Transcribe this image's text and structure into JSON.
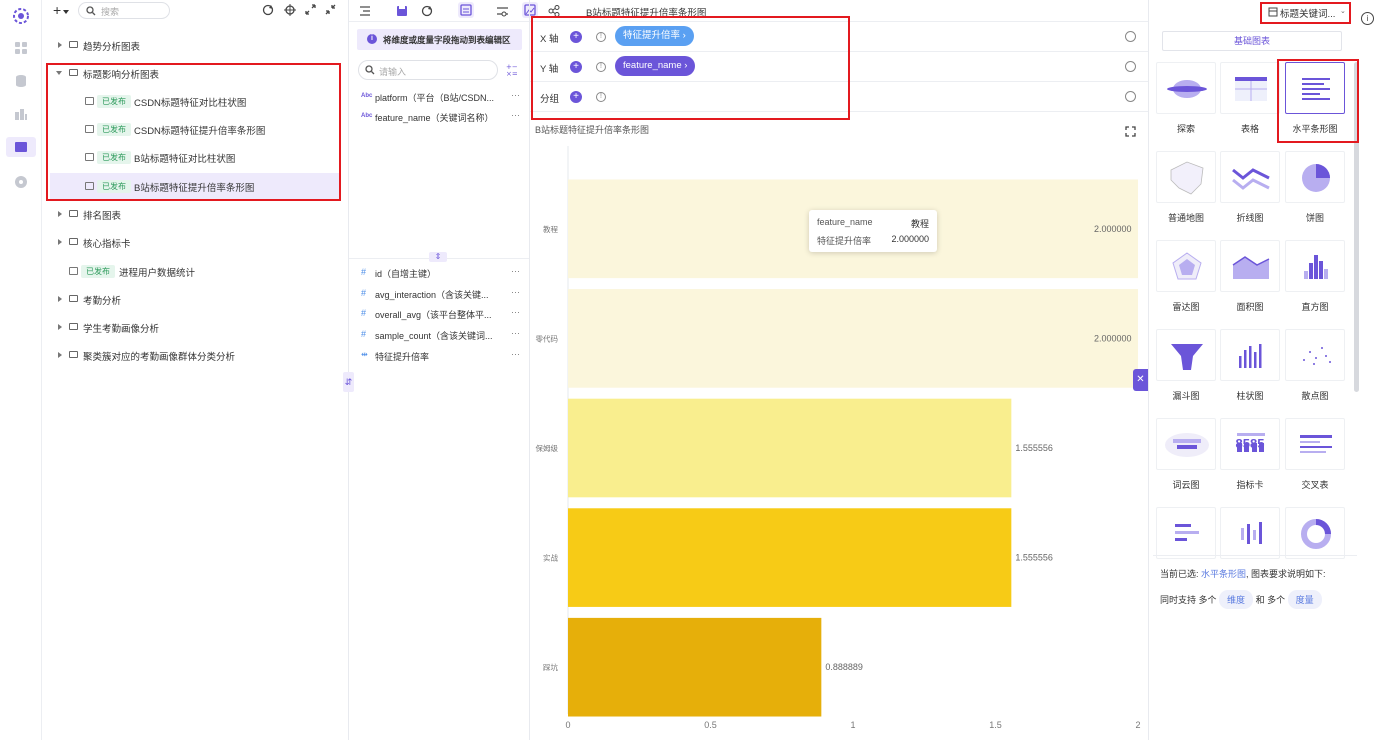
{
  "search": {
    "placeholder": "搜索"
  },
  "tree": {
    "items": [
      {
        "label": "趋势分析图表"
      },
      {
        "label": "标题影响分析图表"
      },
      {
        "badge": "已发布",
        "label": "CSDN标题特征对比柱状图"
      },
      {
        "badge": "已发布",
        "label": "CSDN标题特征提升倍率条形图"
      },
      {
        "badge": "已发布",
        "label": "B站标题特征对比柱状图"
      },
      {
        "badge": "已发布",
        "label": "B站标题特征提升倍率条形图"
      },
      {
        "label": "排名图表"
      },
      {
        "label": "核心指标卡"
      },
      {
        "badge": "已发布",
        "label": "进程用户数据统计"
      },
      {
        "label": "考勤分析"
      },
      {
        "label": "学生考勤画像分析"
      },
      {
        "label": "聚类簇对应的考勤画像群体分类分析"
      }
    ]
  },
  "editor": {
    "title": "B站标题特征提升倍率条形图",
    "top_right_select": "标题关键词..."
  },
  "fields": {
    "hint": "将维度或度量字段拖动到表编辑区",
    "search_placeholder": "请输入",
    "dimensions": [
      {
        "type": "Abc",
        "name": "platform（平台（B站/CSDN..."
      },
      {
        "type": "Abc",
        "name": "feature_name（关键词名称）"
      }
    ],
    "measures": [
      {
        "name": "id（自增主键）"
      },
      {
        "name": "avg_interaction（含该关键..."
      },
      {
        "name": "overall_avg（该平台整体平..."
      },
      {
        "name": "sample_count（含该关键词..."
      },
      {
        "name": "特征提升倍率"
      }
    ],
    "more": "···"
  },
  "axes": {
    "x_label": "X 轴",
    "x_field": "特征提升倍率 ›",
    "y_label": "Y 轴",
    "y_field": "feature_name ›",
    "group_label": "分组"
  },
  "chart_title": "B站标题特征提升倍率条形图",
  "chart_data": {
    "type": "bar",
    "orientation": "horizontal",
    "categories": [
      "教程",
      "零代码",
      "保姆级",
      "实战",
      "踩坑"
    ],
    "values": [
      2.0,
      2.0,
      1.555556,
      1.555556,
      0.888889
    ],
    "value_labels": [
      "2.000000",
      "2.000000",
      "1.555556",
      "1.555556",
      "0.888889"
    ],
    "xlim": [
      0,
      2
    ],
    "x_ticks": [
      "0",
      "0.5",
      "1",
      "1.5",
      "2"
    ],
    "bar_colors": [
      "#fbf6dc",
      "#fbf6dc",
      "#f9ee8e",
      "#f7cb16",
      "#e6af0a"
    ]
  },
  "tooltip": {
    "row1_key": "feature_name",
    "row1_val": "教程",
    "row2_key": "特征提升倍率",
    "row2_val": "2.000000"
  },
  "chart_types": {
    "tab": "基础图表",
    "items": [
      {
        "label": "探索"
      },
      {
        "label": "表格"
      },
      {
        "label": "水平条形图"
      },
      {
        "label": "普通地图"
      },
      {
        "label": "折线图"
      },
      {
        "label": "饼图"
      },
      {
        "label": "雷达图"
      },
      {
        "label": "面积图"
      },
      {
        "label": "直方图"
      },
      {
        "label": "漏斗图"
      },
      {
        "label": "柱状图"
      },
      {
        "label": "散点图"
      },
      {
        "label": "词云图"
      },
      {
        "label": "指标卡"
      },
      {
        "label": "交叉表"
      }
    ],
    "metric_text": "8585",
    "current_prefix": "当前已选:",
    "current_name": "水平条形图",
    "current_suffix": ", 图表要求说明如下:",
    "support_prefix": "同时支持 多个",
    "support_dim": "维度",
    "support_mid": "和 多个",
    "support_measure": "度量"
  },
  "colors": {
    "accent": "#6b55d9",
    "pill_blue": "#5aa0f2",
    "highlight": "#e3191f"
  }
}
